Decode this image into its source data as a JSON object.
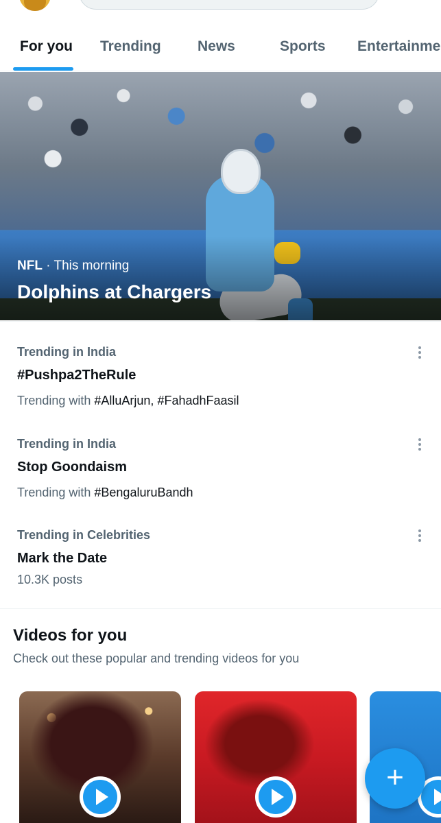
{
  "tabs": [
    "For you",
    "Trending",
    "News",
    "Sports",
    "Entertainment"
  ],
  "active_tab": "For you",
  "hero": {
    "category": "NFL",
    "separator": " · ",
    "time": "This morning",
    "title": "Dolphins at Chargers"
  },
  "trends": [
    {
      "category": "Trending in India",
      "title": "#Pushpa2TheRule",
      "sub_prefix": "Trending with ",
      "sub_tags": "#AlluArjun, #FahadhFaasil"
    },
    {
      "category": "Trending in India",
      "title": "Stop Goondaism",
      "sub_prefix": "Trending with ",
      "sub_tags": "#BengaluruBandh"
    },
    {
      "category": "Trending in Celebrities",
      "title": "Mark the Date",
      "sub_prefix": "10.3K posts",
      "sub_tags": ""
    }
  ],
  "videos_section": {
    "title": "Videos for you",
    "subtitle": "Check out these popular and trending videos for you"
  },
  "fab": {
    "label": "+"
  },
  "colors": {
    "accent": "#1d9bf0",
    "text": "#0f1419",
    "secondary": "#536471"
  }
}
